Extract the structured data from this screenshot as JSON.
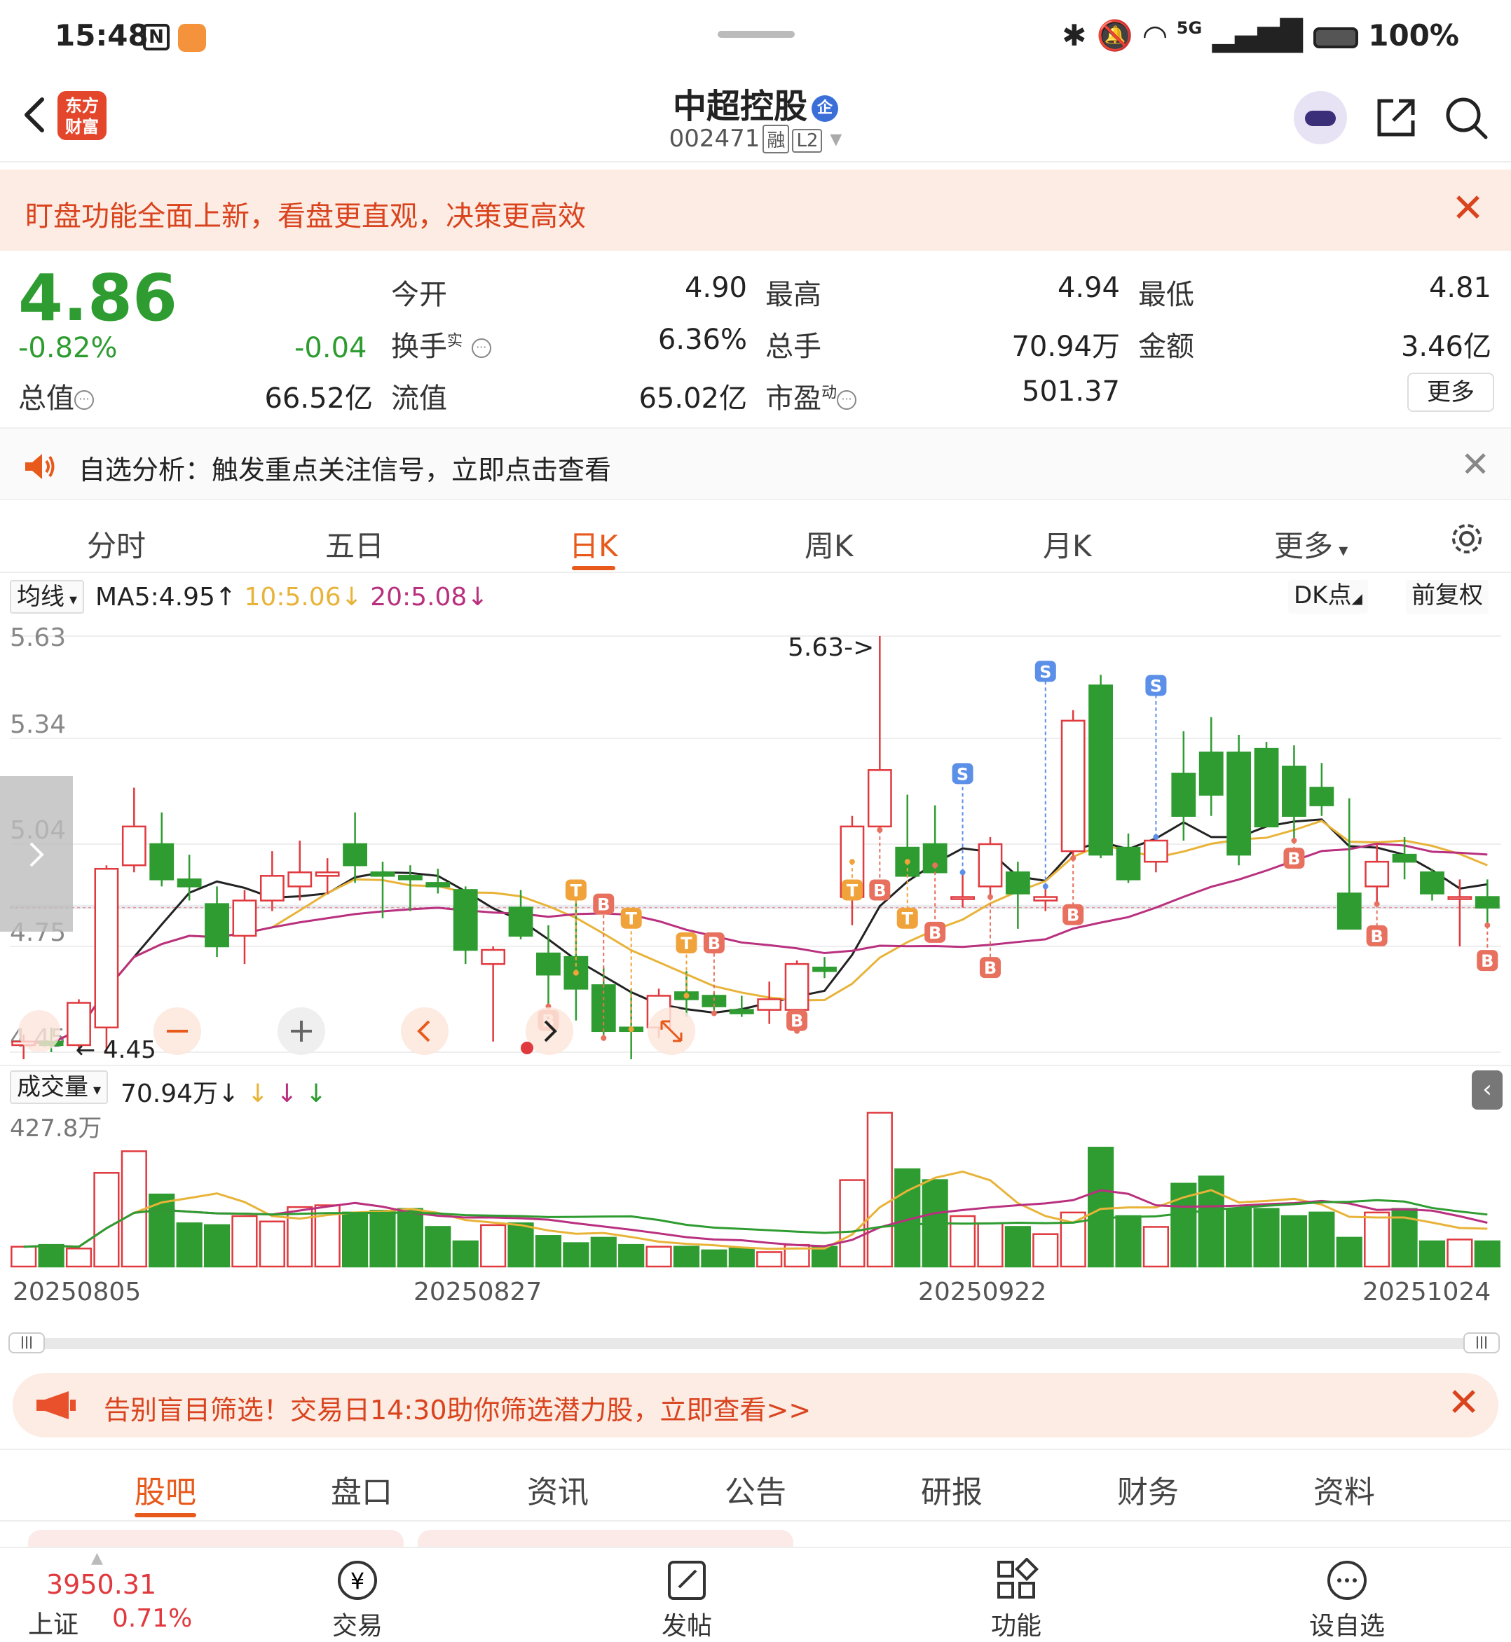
{
  "status": {
    "time": "15:48",
    "n_icon": "N",
    "battery": "100%",
    "network": "5G"
  },
  "header": {
    "title": "中超控股",
    "qi": "企",
    "code": "002471",
    "tag_rong": "融",
    "tag_l2": "L2",
    "logo_line1": "东方",
    "logo_line2": "财富"
  },
  "banner": {
    "text": "盯盘功能全面上新，看盘更直观，决策更高效"
  },
  "quote": {
    "price": "4.86",
    "pct": "-0.82%",
    "change": "-0.04",
    "open_label": "今开",
    "open": "4.90",
    "high_label": "最高",
    "high": "4.94",
    "low_label": "最低",
    "low": "4.81",
    "turnover_label": "换手",
    "turnover_sup": "实",
    "turnover": "6.36%",
    "volume_label": "总手",
    "volume": "70.94万",
    "amount_label": "金额",
    "amount": "3.46亿",
    "mktcap_label": "总值",
    "mktcap": "66.52亿",
    "float_label": "流值",
    "float": "65.02亿",
    "pe_label": "市盈",
    "pe_sup": "动",
    "pe": "501.37",
    "more": "更多"
  },
  "notice": {
    "text": "自选分析：触发重点关注信号，立即点击查看"
  },
  "ktabs": [
    "分时",
    "五日",
    "日K",
    "周K",
    "月K",
    "更多"
  ],
  "marow": {
    "chip": "均线",
    "ma5": "MA5:4.95",
    "ma10": "10:5.06",
    "ma20": "20:5.08",
    "dk": "DK点",
    "fq": "前复权",
    "ma5_color": "#222222",
    "ma10_color": "#e8b339",
    "ma20_color": "#b9307f"
  },
  "chart_data": {
    "type": "candlestick",
    "y_ticks": [
      "5.63",
      "5.34",
      "5.04",
      "4.75",
      "4.45"
    ],
    "ylim": [
      4.45,
      5.63
    ],
    "max_label": "5.63->",
    "min_label": "4.45",
    "candles": [
      [
        4.47,
        4.5,
        4.43,
        4.48
      ],
      [
        4.48,
        4.52,
        4.45,
        4.47
      ],
      [
        4.47,
        4.6,
        4.46,
        4.59
      ],
      [
        4.52,
        4.98,
        4.45,
        4.97
      ],
      [
        4.98,
        5.2,
        4.96,
        5.09
      ],
      [
        5.04,
        5.13,
        4.92,
        4.94
      ],
      [
        4.94,
        5.01,
        4.88,
        4.92
      ],
      [
        4.87,
        4.92,
        4.72,
        4.75
      ],
      [
        4.78,
        4.91,
        4.7,
        4.88
      ],
      [
        4.88,
        5.02,
        4.85,
        4.95
      ],
      [
        4.92,
        5.05,
        4.88,
        4.96
      ],
      [
        4.95,
        5.0,
        4.9,
        4.96
      ],
      [
        5.04,
        5.13,
        4.93,
        4.98
      ],
      [
        4.96,
        4.99,
        4.83,
        4.95
      ],
      [
        4.95,
        4.98,
        4.85,
        4.94
      ],
      [
        4.93,
        4.97,
        4.9,
        4.92
      ],
      [
        4.91,
        4.92,
        4.7,
        4.74
      ],
      [
        4.7,
        4.75,
        4.48,
        4.74
      ],
      [
        4.86,
        4.91,
        4.77,
        4.78
      ],
      [
        4.73,
        4.81,
        4.58,
        4.67
      ],
      [
        4.72,
        4.89,
        4.54,
        4.63
      ],
      [
        4.64,
        4.69,
        4.49,
        4.51
      ],
      [
        4.52,
        4.63,
        4.43,
        4.51
      ],
      [
        4.52,
        4.63,
        4.49,
        4.61
      ],
      [
        4.62,
        4.68,
        4.55,
        4.6
      ],
      [
        4.61,
        4.62,
        4.56,
        4.58
      ],
      [
        4.57,
        4.61,
        4.55,
        4.56
      ],
      [
        4.57,
        4.65,
        4.53,
        4.6
      ],
      [
        4.57,
        4.71,
        4.51,
        4.7
      ],
      [
        4.69,
        4.72,
        4.66,
        4.68
      ],
      [
        4.89,
        5.12,
        4.81,
        5.09
      ],
      [
        5.09,
        5.63,
        5.08,
        5.25
      ],
      [
        5.03,
        5.18,
        4.95,
        4.95
      ],
      [
        5.04,
        5.15,
        4.98,
        4.96
      ],
      [
        4.89,
        4.96,
        4.86,
        4.89
      ],
      [
        4.92,
        5.06,
        4.89,
        5.04
      ],
      [
        4.96,
        4.99,
        4.8,
        4.9
      ],
      [
        4.88,
        4.92,
        4.85,
        4.89
      ],
      [
        5.02,
        5.42,
        5.0,
        5.39
      ],
      [
        5.49,
        5.52,
        5.0,
        5.01
      ],
      [
        5.03,
        5.07,
        4.93,
        4.94
      ],
      [
        4.99,
        5.06,
        4.96,
        5.05
      ],
      [
        5.24,
        5.36,
        5.05,
        5.12
      ],
      [
        5.3,
        5.4,
        5.12,
        5.18
      ],
      [
        5.3,
        5.35,
        4.98,
        5.01
      ],
      [
        5.31,
        5.33,
        5.09,
        5.09
      ],
      [
        5.26,
        5.32,
        5.05,
        5.12
      ],
      [
        5.2,
        5.27,
        5.12,
        5.15
      ],
      [
        4.9,
        5.17,
        4.8,
        4.8
      ],
      [
        4.92,
        5.04,
        4.87,
        4.99
      ],
      [
        5.01,
        5.06,
        4.94,
        4.99
      ],
      [
        4.96,
        4.97,
        4.88,
        4.9
      ],
      [
        4.89,
        4.94,
        4.75,
        4.89
      ],
      [
        4.89,
        4.94,
        4.81,
        4.86
      ]
    ],
    "signals": [
      {
        "label": "T",
        "index": 20,
        "price": 4.91
      },
      {
        "label": "B",
        "index": 21,
        "price": 4.87
      },
      {
        "label": "T",
        "index": 22,
        "price": 4.83
      },
      {
        "label": "T",
        "index": 24,
        "price": 4.76
      },
      {
        "label": "B",
        "index": 25,
        "price": 4.76
      },
      {
        "label": "B",
        "index": 28,
        "price": 4.54
      },
      {
        "label": "T",
        "index": 30,
        "price": 4.91
      },
      {
        "label": "B",
        "index": 31,
        "price": 4.91
      },
      {
        "label": "T",
        "index": 32,
        "price": 4.83
      },
      {
        "label": "S",
        "index": 34,
        "price": 5.24
      },
      {
        "label": "B",
        "index": 33,
        "price": 4.79
      },
      {
        "label": "B",
        "index": 35,
        "price": 4.69
      },
      {
        "label": "S",
        "index": 37,
        "price": 5.53
      },
      {
        "label": "B",
        "index": 38,
        "price": 4.84
      },
      {
        "label": "S",
        "index": 41,
        "price": 5.49
      },
      {
        "label": "B",
        "index": 46,
        "price": 5.0
      },
      {
        "label": "B",
        "index": 49,
        "price": 4.78
      },
      {
        "label": "B",
        "index": 53,
        "price": 4.71
      },
      {
        "label": "B",
        "index": 19,
        "price": 4.54
      }
    ]
  },
  "volume": {
    "chip": "成交量",
    "value": "70.94万",
    "ma1": [
      60,
      58,
      55,
      100,
      150,
      180,
      200,
      180,
      160,
      150,
      150,
      140,
      145,
      150,
      150,
      140,
      130,
      120,
      115,
      110,
      100,
      90,
      80,
      70,
      65,
      60,
      55,
      50,
      50,
      50,
      90,
      160,
      250,
      290,
      260,
      220,
      170,
      150,
      130,
      160,
      170,
      180,
      190,
      200,
      200,
      180,
      170,
      150,
      130,
      130,
      140,
      120,
      100,
      89
    ],
    "ma2": [
      80,
      80,
      80,
      90,
      110,
      130,
      150,
      150,
      150,
      150,
      155,
      155,
      160,
      160,
      160,
      150,
      150,
      145,
      140,
      130,
      125,
      120,
      110,
      100,
      95,
      90,
      85,
      80,
      80,
      80,
      90,
      110,
      140,
      160,
      170,
      180,
      170,
      160,
      155,
      160,
      160,
      165,
      175,
      180,
      180,
      175,
      170,
      170,
      160,
      150,
      150,
      140,
      130,
      117
    ],
    "ma3": [
      100,
      100,
      100,
      110,
      120,
      130,
      140,
      145,
      150,
      150,
      150,
      150,
      150,
      155,
      155,
      155,
      150,
      150,
      150,
      145,
      140,
      135,
      130,
      125,
      120,
      115,
      110,
      105,
      100,
      100,
      105,
      115,
      130,
      145,
      155,
      160,
      165,
      165,
      165,
      165,
      165,
      165,
      170,
      170,
      170,
      170,
      170,
      170,
      165,
      165,
      160,
      155,
      150,
      142
    ],
    "ma1_color": "#e8b339",
    "ma2_color": "#b9307f",
    "ma3_color": "#2e9c30",
    "max_label": "427.8万",
    "ylim": [
      0,
      427.8
    ],
    "values": [
      55,
      60,
      50,
      260,
      320,
      200,
      120,
      115,
      140,
      125,
      165,
      170,
      150,
      155,
      160,
      110,
      70,
      115,
      120,
      85,
      65,
      80,
      60,
      55,
      55,
      45,
      50,
      40,
      60,
      55,
      240,
      427,
      270,
      240,
      140,
      120,
      110,
      90,
      150,
      330,
      140,
      110,
      230,
      250,
      160,
      160,
      140,
      150,
      80,
      150,
      160,
      70,
      75,
      70
    ]
  },
  "dates": [
    "20250805",
    "20250827",
    "20250922",
    "20251024"
  ],
  "ad": {
    "text": "告别盲目筛选！交易日14:30助你筛选潜力股，立即查看>>"
  },
  "btabs": [
    "股吧",
    "盘口",
    "资讯",
    "公告",
    "研报",
    "财务",
    "资料"
  ],
  "nav": {
    "index_value": "3950.31",
    "index_name": "上证",
    "index_pct": "0.71%",
    "trade": "交易",
    "post": "发帖",
    "func": "功能",
    "fav": "设自选"
  },
  "colors": {
    "up": "#e0393e",
    "down": "#2e9c30",
    "accent": "#e85a1c"
  }
}
